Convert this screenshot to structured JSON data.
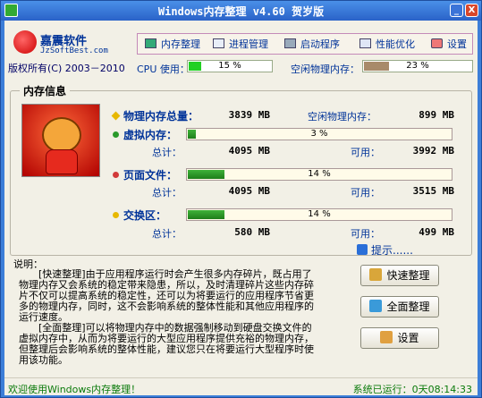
{
  "window": {
    "title": "Windows内存整理 v4.60 贺岁版",
    "minimize_glyph": "_",
    "close_glyph": "X"
  },
  "header": {
    "logo_name": "嘉震软件",
    "logo_url": "JzSoftBest.com",
    "copyright": "版权所有(C) 2003－2010",
    "logo_icon": "red-ball-icon"
  },
  "toolbar": {
    "items": [
      {
        "label": "内存整理",
        "icon": "memory-icon"
      },
      {
        "label": "进程管理",
        "icon": "list-icon"
      },
      {
        "label": "启动程序",
        "icon": "computer-icon"
      },
      {
        "label": "性能优化",
        "icon": "chart-icon"
      },
      {
        "label": "设置",
        "icon": "tools-icon"
      }
    ]
  },
  "stats": {
    "cpu_label": "CPU 使用：",
    "cpu_percent": 15,
    "cpu_text": "15 %",
    "free_label": "空闲物理内存：",
    "free_percent": 23,
    "free_text": "23 %"
  },
  "memory": {
    "group_title": "内存信息",
    "physical": {
      "label": "物理内存总量：",
      "value": "3839 MB",
      "free_label": "空闲物理内存：",
      "free_value": "899 MB"
    },
    "virtual": {
      "label": "虚拟内存：",
      "percent": 3,
      "percent_text": "3 %",
      "total_label": "总计：",
      "total_value": "4095 MB",
      "avail_label": "可用：",
      "avail_value": "3992 MB"
    },
    "pagefile": {
      "label": "页面文件：",
      "percent": 14,
      "percent_text": "14 %",
      "total_label": "总计：",
      "total_value": "4095 MB",
      "avail_label": "可用：",
      "avail_value": "3515 MB"
    },
    "swap": {
      "label": "交换区：",
      "percent": 14,
      "percent_text": "14 %",
      "total_label": "总计：",
      "total_value": "580 MB",
      "avail_label": "可用：",
      "avail_value": "499 MB"
    },
    "colors": {
      "bar": "#1e8e1a",
      "bar_bg": "#fffbe9",
      "label": "#003399"
    }
  },
  "description": {
    "title": "说明：",
    "para1": "[快速整理]由于应用程序运行时会产生很多内存碎片，既占用了物理内存又会系统的稳定带来隐患，所以，及时清理碎片这些内存碎片不仅可以提高系统的稳定性，还可以为将要运行的应用程序节省更多的物理内存，同时，这不会影响系统的整体性能和其他应用程序的运行速度。",
    "para2": "[全面整理]可以将物理内存中的数据强制移动到硬盘交换文件的虚拟内存中，从而为将要运行的大型应用程序提供充裕的物理内存，但整理后会影响系统的整体性能，建议您只在将要运行大型程序时使用该功能。"
  },
  "side": {
    "tip": "提示......",
    "quick_button": "快速整理",
    "full_button": "全面整理",
    "settings_button": "设置"
  },
  "status": {
    "left": "欢迎使用Windows内存整理！",
    "right": "系统已运行：0天08:14:33"
  }
}
